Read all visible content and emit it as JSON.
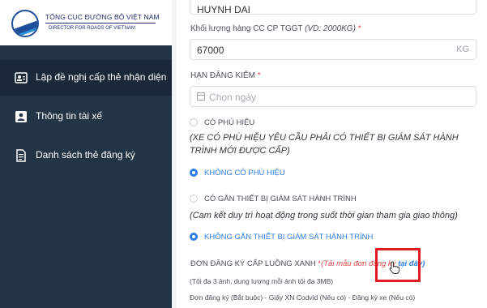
{
  "logo": {
    "title": "TỔNG CỤC ĐƯỜNG BỘ VIỆT NAM",
    "subtitle": "DIRECTOR FOR ROADS OF VIETNAM"
  },
  "sidebar": {
    "items": [
      {
        "label": "Lập đề nghị cấp thẻ nhận diện",
        "icon": "id-card-icon",
        "active": true
      },
      {
        "label": "Thông tin tài xế",
        "icon": "driver-icon",
        "active": false
      },
      {
        "label": "Danh sách thẻ đăng ký",
        "icon": "list-document-icon",
        "active": false
      }
    ]
  },
  "form": {
    "brand_value": "HUYNH DAI",
    "weight_label": "Khối lượng hàng CC CP TGGT",
    "weight_hint": "(VD: 2000KG)",
    "weight_value": "67000",
    "weight_unit": "KG",
    "inspection_label": "HẠN ĐĂNG KIỂM",
    "inspection_placeholder": "Chọn ngày",
    "badge_option_label": "CÓ PHÙ HIỆU",
    "badge_note": "(XE CÓ PHÙ HIỆU YÊU CẦU PHẢI CÓ THIẾT BỊ GIÁM SÁT HÀNH TRÌNH MỚI ĐƯỢC CẤP)",
    "no_badge_option_label": "KHÔNG CÓ PHÙ HIỆU",
    "gps_option_label": "CÓ GẮN THIẾT BỊ GIÁM SÁT HÀNH TRÌNH",
    "gps_note": "(Cam kết duy trì hoạt động trong suốt thời gian tham gia giao thông)",
    "no_gps_option_label": "KHÔNG GẮN THIẾT BỊ GIÁM SÁT HÀNH TRÌNH",
    "green_lane_label": "ĐƠN ĐĂNG KÝ CẤP LUỒNG XANH",
    "template_prefix": "(Tải mẫu đơn đăng ký",
    "template_link": "tại đây)",
    "upload_hint": "(Tối đa 3 ảnh, dung lượng mỗi ảnh tối đa 3MB)",
    "docs_list": "Đơn đăng ký (Bắt buộc) - Giấy XN Codvid (Nếu có) - Đăng ký xe (Nếu có)"
  },
  "colors": {
    "sidebar_bg": "#243447",
    "accent": "#2f7de1",
    "highlight": "#e21b22",
    "required": "#e0464b"
  }
}
